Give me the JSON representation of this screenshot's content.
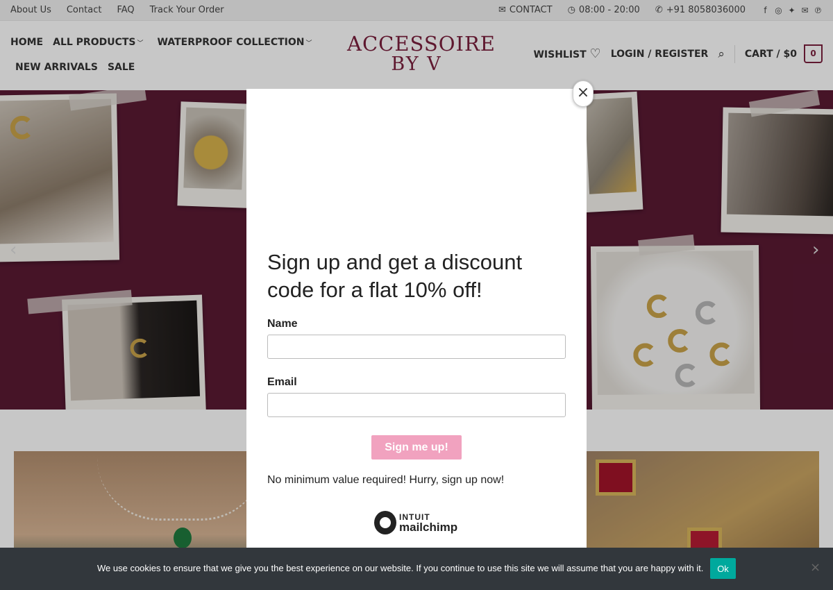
{
  "topbar": {
    "links": [
      "About Us",
      "Contact",
      "FAQ",
      "Track Your Order"
    ],
    "contact_label": "CONTACT",
    "hours": "08:00 - 20:00",
    "phone": "+91 8058036000",
    "social_icons": [
      "facebook-icon",
      "instagram-icon",
      "twitter-icon",
      "mail-icon",
      "pinterest-icon"
    ]
  },
  "nav": {
    "home": "HOME",
    "all_products": "ALL PRODUCTS",
    "waterproof": "WATERPROOF COLLECTION",
    "new_arrivals": "NEW ARRIVALS",
    "sale": "SALE"
  },
  "logo": {
    "line1": "ACCESSOIRE",
    "line2": "BY V"
  },
  "header_right": {
    "wishlist": "WISHLIST",
    "login": "LOGIN / REGISTER",
    "cart": "CART / $0",
    "cart_count": "0"
  },
  "modal": {
    "heading": "Sign up and get a discount code for a flat 10% off!",
    "name_label": "Name",
    "email_label": "Email",
    "submit": "Sign me up!",
    "note": "No minimum value required! Hurry, sign up now!",
    "brand_line1": "INTUIT",
    "brand_line2": "mailchimp",
    "close": "×"
  },
  "cookie": {
    "message": "We use cookies to ensure that we give you the best experience on our website. If you continue to use this site we will assume that you are happy with it.",
    "ok": "Ok",
    "close": "×"
  },
  "colors": {
    "brand": "#7a1f3d",
    "hero_bg": "#5a1a33",
    "signup_button": "#f1a2bf",
    "cookie_ok": "#00a99d",
    "cookie_bar": "#32373c"
  }
}
